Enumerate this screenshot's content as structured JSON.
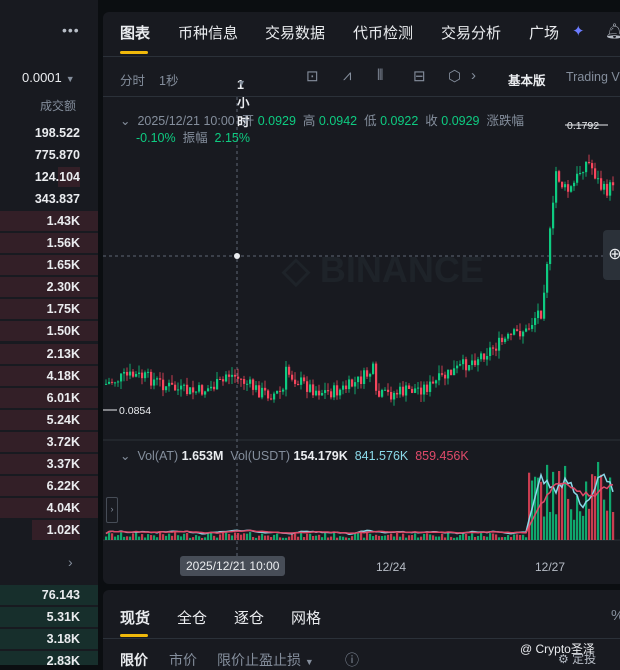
{
  "order_book": {
    "menu_icon": "more-dots-icon",
    "step": "0.0001",
    "header": "成交额",
    "asks": [
      "198.522",
      "775.870",
      "124.104",
      "343.837",
      "1.43K",
      "1.56K",
      "1.65K",
      "2.30K",
      "1.75K",
      "1.50K",
      "2.13K",
      "4.18K",
      "6.01K",
      "5.24K",
      "3.72K",
      "3.37K",
      "6.22K",
      "4.04K",
      "1.02K"
    ],
    "bids": [
      "76.143",
      "5.31K",
      "3.18K",
      "2.83K"
    ],
    "ask_color": "#f6465d",
    "bid_color": "#0ecb81"
  },
  "header_tabs": [
    "图表",
    "币种信息",
    "交易数据",
    "代币检测",
    "交易分析",
    "广场"
  ],
  "toolbar": {
    "intervals": [
      "分时",
      "1秒"
    ],
    "selected_interval": "1小时",
    "icons": [
      "indicator-icon",
      "line-chart-icon",
      "candle-type-icon",
      "replay-icon",
      "settings-hex-icon",
      "chevron-right-icon"
    ],
    "mode_basic": "基本版",
    "mode_tv": "Trading V"
  },
  "ohlc": {
    "datetime": "2025/12/21 10:00",
    "open_label": "开",
    "open": "0.0929",
    "high_label": "高",
    "high": "0.0942",
    "low_label": "低",
    "low": "0.0922",
    "close_label": "收",
    "close": "0.0929",
    "change_label": "涨跌幅",
    "change": "-0.10%",
    "amp_label": "振幅",
    "amp": "2.15%"
  },
  "price_marks": {
    "max": "0.1792",
    "min": "0.0854"
  },
  "volume": {
    "label_at": "Vol(AT)",
    "value_at": "1.653M",
    "label_usdt": "Vol(USDT)",
    "value_usdt": "154.179K",
    "ma1": "841.576K",
    "ma2": "859.456K"
  },
  "x_axis": {
    "cursor": "2025/12/21 10:00",
    "ticks": [
      "12/24",
      "12/27"
    ]
  },
  "watermark_logo": "BINANCE",
  "trade_tabs": [
    "现货",
    "全仓",
    "逐仓",
    "网格"
  ],
  "order_types": [
    "限价",
    "市价",
    "限价止盈止损"
  ],
  "footer": {
    "credit": "@ Crypto圣泽",
    "fixed": "定投"
  },
  "colors": {
    "accent": "#f0b90b",
    "up": "#0ecb81",
    "down": "#f6465d",
    "ma_cyan": "#8ad8e8",
    "ma_pink": "#e04a6a"
  }
}
